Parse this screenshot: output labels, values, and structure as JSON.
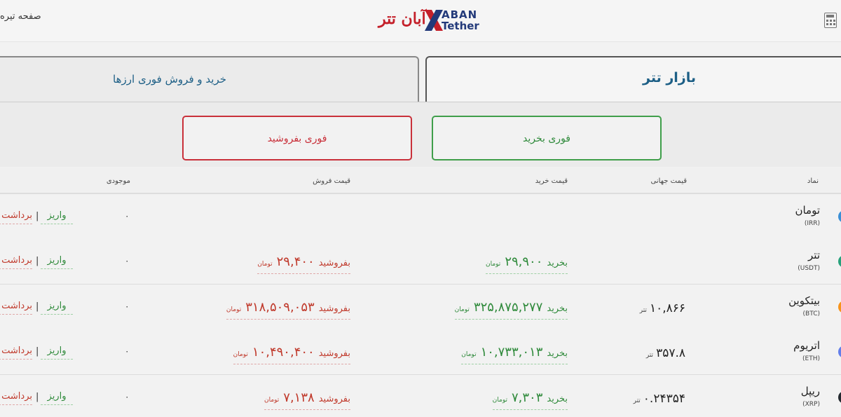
{
  "header": {
    "nav_link": "صفحه تیره",
    "logo_fa": "آبان تتر",
    "logo_en_top": "ABAN",
    "logo_en_bottom": "Tether"
  },
  "tabs": [
    {
      "label": "بازار تتر",
      "active": true
    },
    {
      "label": "خرید و فروش فوری ارزها",
      "active": false
    }
  ],
  "actions": {
    "buy_label": "فوری بخرید",
    "sell_label": "فوری بفروشید"
  },
  "table": {
    "headers": {
      "symbol": "نماد",
      "world_price": "قیمت جهانی",
      "buy_price": "قیمت خرید",
      "sell_price": "قیمت فروش",
      "balance": "موجودی"
    },
    "buy_word": "بخرید",
    "sell_word": "بفروشید",
    "toman_unit": "تومان",
    "tether_unit": "تتر",
    "deposit_label": "واریز",
    "withdraw_label": "برداشت",
    "separator": "|",
    "rows": [
      {
        "name": "تومان",
        "symbol": "(IRR)",
        "world": "",
        "buy": "",
        "sell": "",
        "balance": "۰",
        "dot_color": "#3a8fd6"
      },
      {
        "name": "تتر",
        "symbol": "(USDT)",
        "world": "",
        "buy": "۲۹,۹۰۰",
        "sell": "۲۹,۴۰۰",
        "balance": "۰",
        "dot_color": "#26a17b"
      },
      {
        "name": "بیتکوین",
        "symbol": "(BTC)",
        "world": "۱۰,۸۶۶",
        "buy": "۳۲۵,۸۷۵,۲۷۷",
        "sell": "۳۱۸,۵۰۹,۰۵۳",
        "balance": "۰",
        "dot_color": "#f7931a"
      },
      {
        "name": "اتریوم",
        "symbol": "(ETH)",
        "world": "۳۵۷.۸",
        "buy": "۱۰,۷۳۳,۰۱۳",
        "sell": "۱۰,۴۹۰,۴۰۰",
        "balance": "۰",
        "dot_color": "#627eea"
      },
      {
        "name": "ریپل",
        "symbol": "(XRP)",
        "world": "۰.۲۴۳۵۴",
        "buy": "۷,۳۰۳",
        "sell": "۷,۱۳۸",
        "balance": "۰",
        "dot_color": "#23292f"
      }
    ]
  }
}
